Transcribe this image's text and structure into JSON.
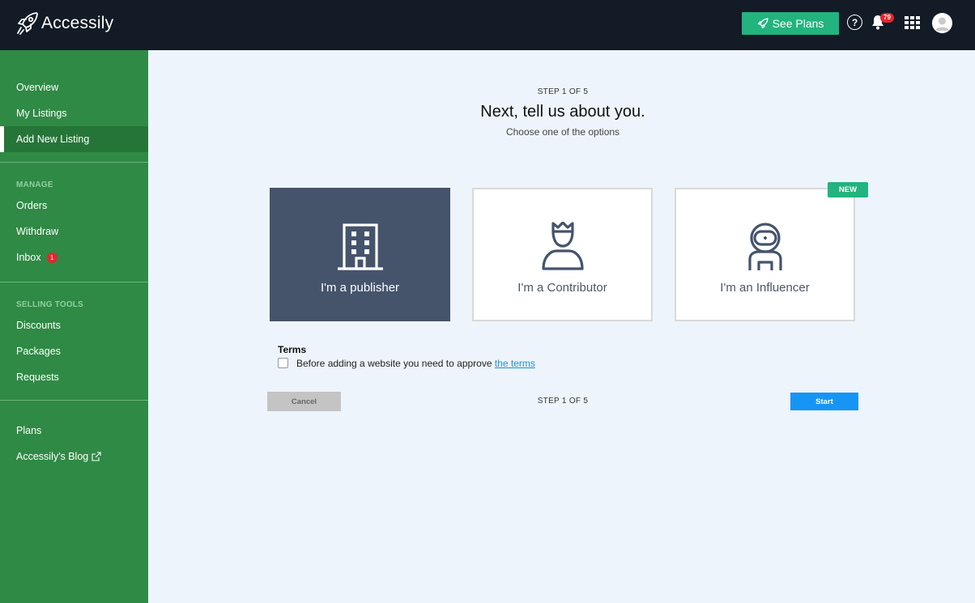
{
  "app": {
    "name": "Accessily"
  },
  "topbar": {
    "see_plans_label": "See Plans",
    "help_symbol": "?",
    "notification_count": "79",
    "icons": [
      "rocket-icon",
      "help-icon",
      "bell-icon",
      "apps-grid-icon",
      "avatar"
    ]
  },
  "sidebar": {
    "primary": [
      {
        "label": "Overview"
      },
      {
        "label": "My Listings"
      },
      {
        "label": "Add New Listing",
        "active": true
      }
    ],
    "manage_label": "MANAGE",
    "manage": [
      {
        "label": "Orders"
      },
      {
        "label": "Withdraw"
      },
      {
        "label": "Inbox",
        "badge": "1"
      }
    ],
    "selling_tools_label": "SELLING TOOLS",
    "selling_tools": [
      {
        "label": "Discounts"
      },
      {
        "label": "Packages"
      },
      {
        "label": "Requests"
      }
    ],
    "bottom": [
      {
        "label": "Plans"
      },
      {
        "label": "Accessily's Blog",
        "icon": "external-link-icon"
      }
    ]
  },
  "wizard": {
    "step_text": "STEP 1 OF 5",
    "title": "Next, tell us about you.",
    "subtitle": "Choose one of the options",
    "options": [
      {
        "label": "I'm a publisher",
        "icon": "building-icon",
        "selected": true
      },
      {
        "label": "I'm a Contributor",
        "icon": "crowned-person-icon",
        "selected": false
      },
      {
        "label": "I'm an Influencer",
        "icon": "astronaut-icon",
        "selected": false,
        "badge": "NEW"
      }
    ],
    "terms_title": "Terms",
    "terms_text": "Before adding a website you need to approve ",
    "terms_link": "the terms",
    "terms_checked": false,
    "cancel_label": "Cancel",
    "start_label": "Start"
  },
  "colors": {
    "topbar": "#121b26",
    "sidebar": "#2f8a45",
    "accent_green": "#22b37f",
    "selected_card": "#45546b",
    "primary_blue": "#1795f5",
    "badge_red": "#e4262d"
  }
}
